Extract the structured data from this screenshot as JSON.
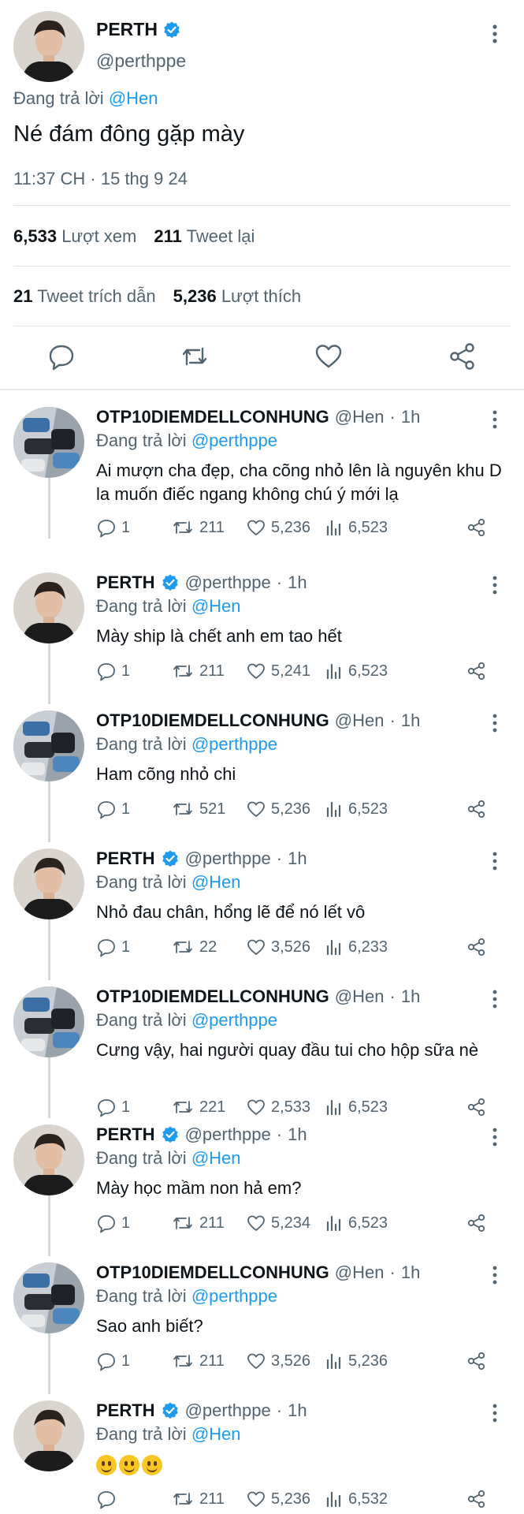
{
  "main_tweet": {
    "author_name": "PERTH",
    "author_handle": "@perthppe",
    "reply_prefix": "Đang trả lời",
    "reply_to": "@Hen",
    "text": "Né đám đông gặp mày",
    "timestamp": "11:37 CH · 15 thg 9 24",
    "views_count": "6,533",
    "views_label": "Lượt xem",
    "retweets_count": "211",
    "retweets_label": "Tweet lại",
    "quotes_count": "21",
    "quotes_label": "Tweet trích dẫn",
    "likes_count": "5,236",
    "likes_label": "Lượt thích"
  },
  "colors": {
    "accent": "#1d9bf0",
    "muted": "#536471",
    "verified": "#1d9bf0"
  },
  "icons": {
    "more": "more-vertical-icon",
    "reply": "reply-icon",
    "retweet": "retweet-icon",
    "like": "heart-icon",
    "views": "views-icon",
    "share": "share-icon",
    "verified": "verified-badge-icon"
  },
  "replies": [
    {
      "name": "OTP10DIEMDELLCONHUNG",
      "handle": "@Hen",
      "time": "1h",
      "verified": false,
      "reply_prefix": "Đang trả lời",
      "reply_to": "@perthppe",
      "text": "Ai mượn cha đẹp, cha cõng nhỏ lên là nguyên khu D la muốn điếc ngang không chú ý mới lạ",
      "replies": "1",
      "retweets": "211",
      "likes": "5,236",
      "views": "6,523"
    },
    {
      "name": "PERTH",
      "handle": "@perthppe",
      "time": "1h",
      "verified": true,
      "reply_prefix": "Đang trả lời",
      "reply_to": "@Hen",
      "text": "Mày ship là chết anh em tao hết",
      "replies": "1",
      "retweets": "211",
      "likes": "5,241",
      "views": "6,523"
    },
    {
      "name": "OTP10DIEMDELLCONHUNG",
      "handle": "@Hen",
      "time": "1h",
      "verified": false,
      "reply_prefix": "Đang trả lời",
      "reply_to": "@perthppe",
      "text": "Ham cõng nhỏ chi",
      "replies": "1",
      "retweets": "521",
      "likes": "5,236",
      "views": "6,523"
    },
    {
      "name": "PERTH",
      "handle": "@perthppe",
      "time": "1h",
      "verified": true,
      "reply_prefix": "Đang trả lời",
      "reply_to": "@Hen",
      "text": "Nhỏ đau chân, hổng lẽ để nó lết vô",
      "replies": "1",
      "retweets": "22",
      "likes": "3,526",
      "views": "6,233"
    },
    {
      "name": "OTP10DIEMDELLCONHUNG",
      "handle": "@Hen",
      "time": "1h",
      "verified": false,
      "reply_prefix": "Đang trả lời",
      "reply_to": "@perthppe",
      "text": "Cưng vậy, hai người quay đầu tui cho hộp sữa nè",
      "replies": "1",
      "retweets": "221",
      "likes": "2,533",
      "views": "6,523"
    },
    {
      "name": "PERTH",
      "handle": "@perthppe",
      "time": "1h",
      "verified": true,
      "reply_prefix": "Đang trả lời",
      "reply_to": "@Hen",
      "text": "Mày học mầm non hả em?",
      "replies": "1",
      "retweets": "211",
      "likes": "5,234",
      "views": "6,523"
    },
    {
      "name": "OTP10DIEMDELLCONHUNG",
      "handle": "@Hen",
      "time": "1h",
      "verified": false,
      "reply_prefix": "Đang trả lời",
      "reply_to": "@perthppe",
      "text": "Sao anh biết?",
      "replies": "1",
      "retweets": "211",
      "likes": "3,526",
      "views": "5,236"
    },
    {
      "name": "PERTH",
      "handle": "@perthppe",
      "time": "1h",
      "verified": true,
      "reply_prefix": "Đang trả lời",
      "reply_to": "@Hen",
      "text": "",
      "emoji_count": 3,
      "emoji": "grinning-face-emoji",
      "replies": "",
      "retweets": "211",
      "likes": "5,236",
      "views": "6,532"
    }
  ]
}
